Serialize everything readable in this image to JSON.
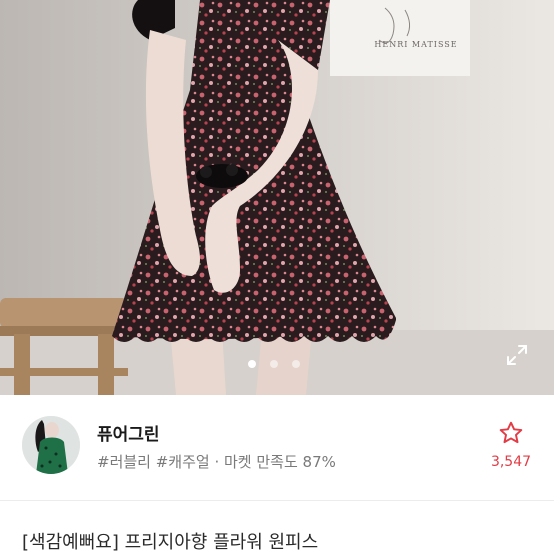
{
  "gallery": {
    "poster_caption": "HENRI MATISSE",
    "slide_count": 3,
    "active_slide": 1,
    "expand_icon": "expand-icon"
  },
  "seller": {
    "name": "퓨어그린",
    "tags": "#러블리 #캐주얼 · 마켓 만족도 87%",
    "favorite_count": "3,547",
    "favorite_icon": "star-outline-icon",
    "accent_color": "#e23c46"
  },
  "product": {
    "title": "[색감예뻐요] 프리지아향 플라워 원피스"
  }
}
